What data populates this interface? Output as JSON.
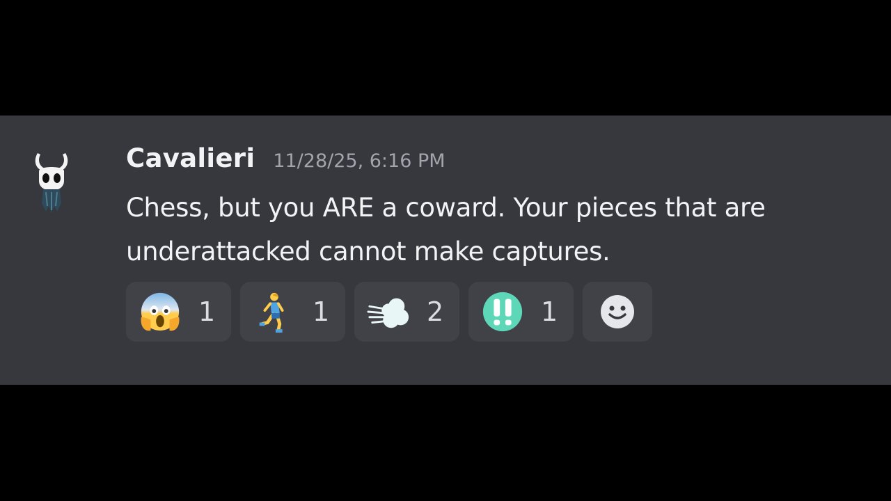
{
  "message": {
    "author": "Cavalieri",
    "timestamp": "11/28/25, 6:16 PM",
    "content": "Chess, but you ARE a coward. Your pieces that are underattacked cannot make captures.",
    "avatar_icon": "hollow-knight-avatar"
  },
  "reactions": [
    {
      "icon": "face-screaming-in-fear-emoji",
      "count": "1"
    },
    {
      "icon": "person-running-emoji",
      "count": "1"
    },
    {
      "icon": "dashing-away-emoji",
      "count": "2"
    },
    {
      "icon": "double-exclamation-emoji",
      "count": "1"
    }
  ],
  "add_reaction_icon": "smiley-add-reaction-icon",
  "colors": {
    "background": "#000000",
    "message_band": "#37373e",
    "reaction_pill": "#414148",
    "username": "#f2f3f5",
    "timestamp": "#a3a5ad",
    "exclamation_circle": "#5ed6b8"
  }
}
